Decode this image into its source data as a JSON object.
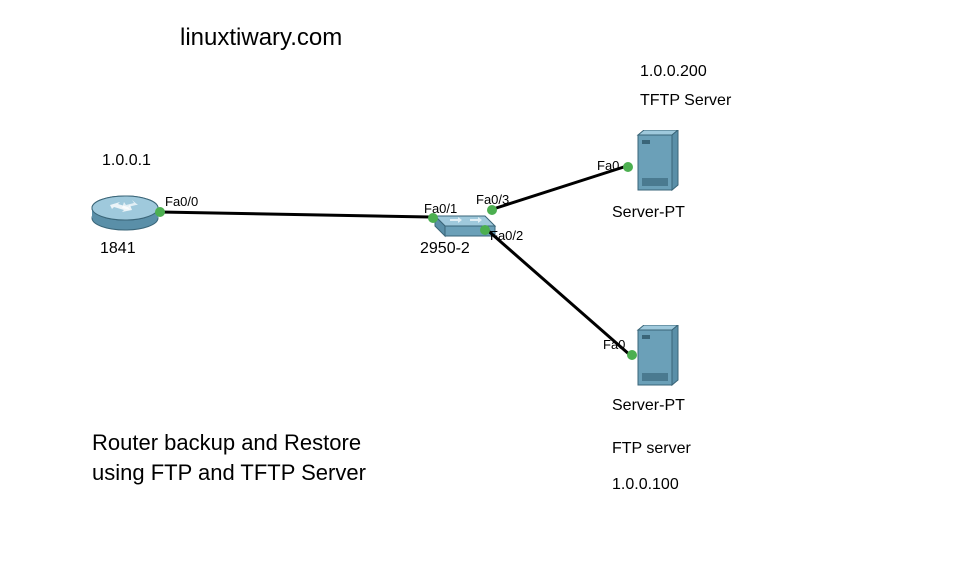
{
  "header": {
    "site_title": "linuxtiwary.com"
  },
  "devices": {
    "router": {
      "model": "1841",
      "ip": "1.0.0.1",
      "port_label": "Fa0/0"
    },
    "switch": {
      "model": "2950-2",
      "port1": "Fa0/1",
      "port2": "Fa0/2",
      "port3": "Fa0/3"
    },
    "server1": {
      "name": "Server-PT",
      "role": "TFTP Server",
      "ip": "1.0.0.200",
      "port_label": "Fa0"
    },
    "server2": {
      "name": "Server-PT",
      "role": "FTP server",
      "ip": "1.0.0.100",
      "port_label": "Fa0"
    }
  },
  "caption": {
    "line1": "Router backup and Restore",
    "line2": "using FTP and TFTP Server"
  }
}
